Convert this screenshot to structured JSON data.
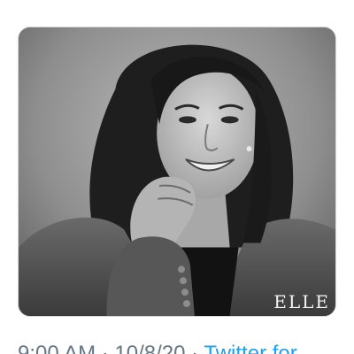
{
  "tweet": {
    "media": {
      "alt_label": "portrait photo",
      "watermark": "ELLE"
    },
    "meta": {
      "time": "9:00 AM",
      "separator": "·",
      "date": "10/8/20",
      "source": "Twitter for"
    }
  },
  "colors": {
    "meta_text": "#657786",
    "link": "#1da1f2",
    "background": "#ffffff"
  }
}
